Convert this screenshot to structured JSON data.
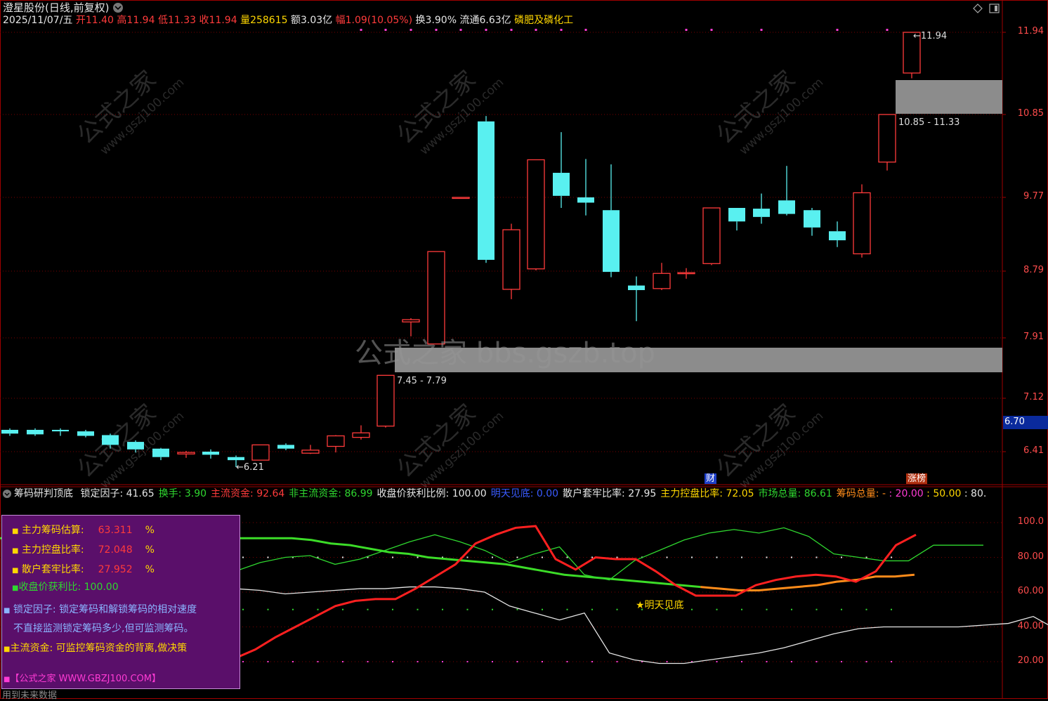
{
  "header": {
    "stock": "澄星股份",
    "period": "(日线,前复权)",
    "date": "2025/11/07/五",
    "open_label": "开",
    "open": "11.40",
    "high_label": "高",
    "high": "11.94",
    "low_label": "低",
    "low": "11.33",
    "close_label": "收",
    "close": "11.94",
    "vol_label": "量",
    "vol": "258615",
    "amount_label": "额",
    "amount": "3.03亿",
    "range_label": "幅",
    "range": "1.09(10.05%)",
    "turnover_label": "换",
    "turnover": "3.90%",
    "float_label": "流通",
    "float": "6.63亿",
    "sector": "磷肥及磷化工"
  },
  "price_axis": [
    "11.94",
    "10.85",
    "9.77",
    "8.79",
    "7.91",
    "7.12",
    "6.41"
  ],
  "current_price": "6.70",
  "annotations": {
    "high_mark": "11.94",
    "low_mark": "6.21",
    "upper_zone": "10.85 - 11.33",
    "lower_zone": "7.45 - 7.79",
    "watermark_center": "公式之家 bbs.gszb.top",
    "watermark_tile_a": "公式之家",
    "watermark_tile_b": "www.gszj100.com",
    "tag_cai": "财",
    "tag_zhangbang": "涨榜"
  },
  "candles": [
    {
      "o": 6.7,
      "h": 6.72,
      "l": 6.62,
      "c": 6.65
    },
    {
      "o": 6.7,
      "h": 6.72,
      "l": 6.62,
      "c": 6.64
    },
    {
      "o": 6.7,
      "h": 6.72,
      "l": 6.62,
      "c": 6.68
    },
    {
      "o": 6.68,
      "h": 6.7,
      "l": 6.6,
      "c": 6.62
    },
    {
      "o": 6.63,
      "h": 6.65,
      "l": 6.45,
      "c": 6.5
    },
    {
      "o": 6.54,
      "h": 6.56,
      "l": 6.4,
      "c": 6.44
    },
    {
      "o": 6.45,
      "h": 6.46,
      "l": 6.3,
      "c": 6.34
    },
    {
      "o": 6.38,
      "h": 6.42,
      "l": 6.33,
      "c": 6.4
    },
    {
      "o": 6.41,
      "h": 6.44,
      "l": 6.32,
      "c": 6.37
    },
    {
      "o": 6.34,
      "h": 6.36,
      "l": 6.21,
      "c": 6.3
    },
    {
      "o": 6.3,
      "h": 6.5,
      "l": 6.3,
      "c": 6.5
    },
    {
      "o": 6.5,
      "h": 6.52,
      "l": 6.43,
      "c": 6.45
    },
    {
      "o": 6.39,
      "h": 6.5,
      "l": 6.38,
      "c": 6.43
    },
    {
      "o": 6.48,
      "h": 6.63,
      "l": 6.4,
      "c": 6.62
    },
    {
      "o": 6.6,
      "h": 6.76,
      "l": 6.57,
      "c": 6.66
    },
    {
      "o": 6.75,
      "h": 7.42,
      "l": 6.73,
      "c": 7.42
    },
    {
      "o": 8.12,
      "h": 8.17,
      "l": 7.93,
      "c": 8.15
    },
    {
      "o": 7.83,
      "h": 9.05,
      "l": 7.83,
      "c": 9.05
    },
    {
      "o": 9.77,
      "h": 9.77,
      "l": 9.77,
      "c": 9.77
    },
    {
      "o": 10.76,
      "h": 10.83,
      "l": 8.9,
      "c": 8.94
    },
    {
      "o": 8.55,
      "h": 9.42,
      "l": 8.42,
      "c": 9.34
    },
    {
      "o": 8.82,
      "h": 10.26,
      "l": 8.8,
      "c": 10.26
    },
    {
      "o": 10.09,
      "h": 10.62,
      "l": 9.63,
      "c": 9.79
    },
    {
      "o": 9.77,
      "h": 10.27,
      "l": 9.53,
      "c": 9.7
    },
    {
      "o": 9.6,
      "h": 10.2,
      "l": 8.71,
      "c": 8.78
    },
    {
      "o": 8.6,
      "h": 8.72,
      "l": 8.13,
      "c": 8.54
    },
    {
      "o": 8.56,
      "h": 8.9,
      "l": 8.54,
      "c": 8.76
    },
    {
      "o": 8.77,
      "h": 8.83,
      "l": 8.69,
      "c": 8.77
    },
    {
      "o": 8.89,
      "h": 9.63,
      "l": 8.87,
      "c": 9.63
    },
    {
      "o": 9.63,
      "h": 9.63,
      "l": 9.33,
      "c": 9.45
    },
    {
      "o": 9.62,
      "h": 9.82,
      "l": 9.42,
      "c": 9.51
    },
    {
      "o": 9.73,
      "h": 10.18,
      "l": 9.53,
      "c": 9.55
    },
    {
      "o": 9.6,
      "h": 9.63,
      "l": 9.26,
      "c": 9.37
    },
    {
      "o": 9.32,
      "h": 9.45,
      "l": 9.11,
      "c": 9.2
    },
    {
      "o": 9.02,
      "h": 9.94,
      "l": 8.97,
      "c": 9.83
    },
    {
      "o": 10.23,
      "h": 10.85,
      "l": 10.12,
      "c": 10.85
    },
    {
      "o": 11.4,
      "h": 11.94,
      "l": 11.33,
      "c": 11.94
    }
  ],
  "indicator": {
    "name": "筹码研判顶底",
    "items": [
      {
        "label": "锁定因子",
        "value": "41.65",
        "color": "#e6e6e6"
      },
      {
        "label": "换手",
        "value": "3.90",
        "color": "#2fd72f"
      },
      {
        "label": "主流资金",
        "value": "92.64",
        "color": "#ff3b3b"
      },
      {
        "label": "非主流资金",
        "value": "86.99",
        "color": "#2fd72f"
      },
      {
        "label": "收盘价获利比例",
        "value": "100.00",
        "color": "#e6e6e6"
      },
      {
        "label": "明天见底",
        "value": "0.00",
        "color": "#3a5bff"
      },
      {
        "label": "散户套牢比率",
        "value": "27.95",
        "color": "#e6e6e6"
      },
      {
        "label": "主力控盘比率",
        "value": "72.05",
        "color": "#ffd700"
      },
      {
        "label": "市场总量",
        "value": "86.61",
        "color": "#2fd72f"
      },
      {
        "label": "筹码总量",
        "value": "-",
        "color": "#ff8c1a"
      }
    ],
    "tail": [
      ": 20.00",
      ": 50.00",
      ": 80."
    ],
    "axis": [
      "100.0",
      "80.00",
      "60.00",
      "40.00",
      "20.00"
    ],
    "signal_label": "★明天见底",
    "series": {
      "main_fund": [
        22,
        27,
        34,
        40,
        46,
        52,
        55,
        56,
        56,
        62,
        69,
        76,
        88,
        93,
        97,
        98,
        79,
        73,
        80,
        79,
        79,
        72,
        64,
        58,
        58,
        58,
        64,
        67,
        69,
        70,
        69,
        66,
        72,
        87,
        93
      ],
      "non_main": [
        72,
        77,
        80,
        81,
        76,
        79,
        84,
        89,
        93,
        89,
        84,
        77,
        82,
        86,
        70,
        67,
        78,
        84,
        90,
        94,
        96,
        94,
        97,
        92,
        82,
        80,
        78,
        78,
        87,
        87,
        87
      ],
      "lock": [
        62,
        61,
        59,
        60,
        61,
        62,
        62,
        63,
        63,
        62,
        60,
        52,
        48,
        44,
        48,
        25,
        21,
        19,
        19,
        21,
        23,
        25,
        28,
        32,
        36,
        39,
        40,
        40,
        40,
        40,
        41,
        42,
        46,
        38,
        36,
        42
      ],
      "market": [
        91,
        91,
        91,
        91,
        91,
        91,
        91,
        91,
        91,
        91,
        91,
        91,
        91,
        91,
        91,
        91,
        90,
        88,
        87,
        85,
        83,
        82,
        80,
        79,
        78,
        77,
        76,
        74,
        72,
        70,
        69,
        68,
        67,
        66,
        65,
        64,
        63,
        62,
        61,
        61,
        62,
        63,
        64,
        66,
        67,
        69,
        69,
        70
      ]
    }
  },
  "panel": {
    "row1_label": "主力筹码估算:",
    "row1_value": "63.311",
    "row1_unit": "%",
    "row2_label": "主力控盘比率:",
    "row2_value": "72.048",
    "row2_unit": "%",
    "row3_label": "散户套牢比率:",
    "row3_value": "27.952",
    "row3_unit": "%",
    "row4_label": "收盘价获利比:",
    "row4_value": "100.00",
    "desc1": "锁定因子: 锁定筹码和解锁筹码的相对速度",
    "desc2": "不直接监测锁定筹码多少,但可监测筹码。",
    "desc3": "主流资金: 可监控筹码资金的背离,做决策",
    "footer": "【公式之家 WWW.GBZJ100.COM】"
  },
  "bottom_note": "用到未来数据",
  "colors": {
    "up": "#ff3b3b",
    "down": "#59f0f0",
    "grid": "#7a0000",
    "zone": "#8c8c8c"
  }
}
